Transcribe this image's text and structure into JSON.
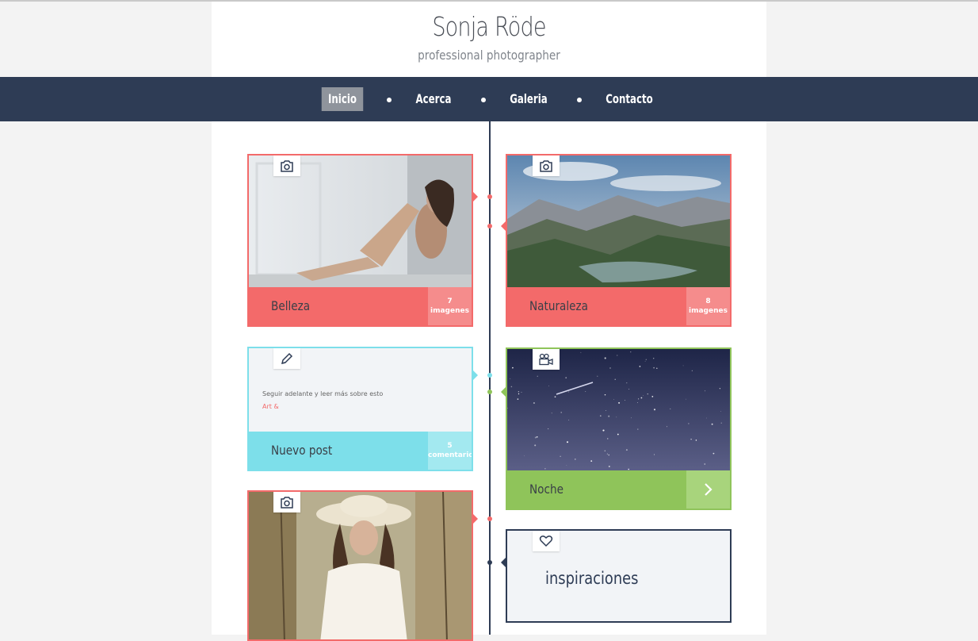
{
  "header": {
    "name": "Sonja Röde",
    "tagline": "professional photographer"
  },
  "nav": {
    "items": [
      {
        "label": "Inicio",
        "active": true
      },
      {
        "label": "Acerca",
        "active": false
      },
      {
        "label": "Galeria",
        "active": false
      },
      {
        "label": "Contacto",
        "active": false
      }
    ]
  },
  "cards": {
    "belleza": {
      "icon": "camera-icon",
      "label": "Belleza",
      "count": "7",
      "count_unit": "imagenes",
      "color": "#f36a6a"
    },
    "naturaleza": {
      "icon": "camera-icon",
      "label": "Naturaleza",
      "count": "8",
      "count_unit": "imagenes",
      "color": "#f36a6a"
    },
    "nuevo_post": {
      "icon": "pencil-icon",
      "excerpt": "Seguir adelante y leer más sobre esto",
      "tag": "Art &",
      "label": "Nuevo post",
      "count": "5",
      "count_unit": "comentarios",
      "color": "#7ddfea"
    },
    "noche": {
      "icon": "video-camera-icon",
      "label": "Noche",
      "color": "#8fc45a"
    },
    "swing_photo": {
      "icon": "camera-icon",
      "color": "#f36a6a"
    },
    "inspiraciones": {
      "icon": "heart-icon",
      "label": "inspiraciones",
      "color": "#2e3c55"
    }
  },
  "colors": {
    "nav_bg": "#2e3c55",
    "active_nav": "#8f949c",
    "red": "#f36a6a",
    "cyan": "#7ddfea",
    "green": "#8fc45a",
    "page_bg": "#f3f3f3"
  }
}
